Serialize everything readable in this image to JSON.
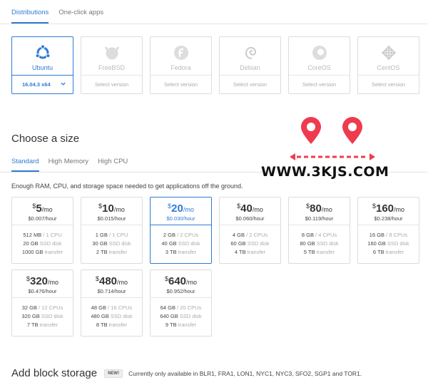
{
  "tabs": [
    "Distributions",
    "One-click apps"
  ],
  "distros": [
    {
      "name": "Ubuntu",
      "version": "16.04.3 x64",
      "icon": "ubuntu-icon",
      "selected": true
    },
    {
      "name": "FreeBSD",
      "version": "Select version",
      "icon": "freebsd-icon"
    },
    {
      "name": "Fedora",
      "version": "Select version",
      "icon": "fedora-icon"
    },
    {
      "name": "Debian",
      "version": "Select version",
      "icon": "debian-icon"
    },
    {
      "name": "CoreOS",
      "version": "Select version",
      "icon": "coreos-icon"
    },
    {
      "name": "CentOS",
      "version": "Select version",
      "icon": "centos-icon"
    }
  ],
  "size": {
    "heading": "Choose a size",
    "tabs": [
      "Standard",
      "High Memory",
      "High CPU"
    ],
    "description": "Enough RAM, CPU, and storage space needed to get applications off the ground."
  },
  "plans": [
    {
      "cur": "$",
      "amount": "5",
      "per": "/mo",
      "hourly": "$0.007/hour",
      "ram": "512 MB",
      "cpu": "1 CPU",
      "disk": "20 GB",
      "disk_label": "SSD disk",
      "transfer": "1000 GB",
      "transfer_label": "transfer"
    },
    {
      "cur": "$",
      "amount": "10",
      "per": "/mo",
      "hourly": "$0.015/hour",
      "ram": "1 GB",
      "cpu": "1 CPU",
      "disk": "30 GB",
      "disk_label": "SSD disk",
      "transfer": "2 TB",
      "transfer_label": "transfer"
    },
    {
      "cur": "$",
      "amount": "20",
      "per": "/mo",
      "hourly": "$0.030/hour",
      "ram": "2 GB",
      "cpu": "2 CPUs",
      "disk": "40 GB",
      "disk_label": "SSD disk",
      "transfer": "3 TB",
      "transfer_label": "transfer",
      "selected": true
    },
    {
      "cur": "$",
      "amount": "40",
      "per": "/mo",
      "hourly": "$0.060/hour",
      "ram": "4 GB",
      "cpu": "2 CPUs",
      "disk": "60 GB",
      "disk_label": "SSD disk",
      "transfer": "4 TB",
      "transfer_label": "transfer"
    },
    {
      "cur": "$",
      "amount": "80",
      "per": "/mo",
      "hourly": "$0.119/hour",
      "ram": "8 GB",
      "cpu": "4 CPUs",
      "disk": "80 GB",
      "disk_label": "SSD disk",
      "transfer": "5 TB",
      "transfer_label": "transfer"
    },
    {
      "cur": "$",
      "amount": "160",
      "per": "/mo",
      "hourly": "$0.238/hour",
      "ram": "16 GB",
      "cpu": "8 CPUs",
      "disk": "160 GB",
      "disk_label": "SSD disk",
      "transfer": "6 TB",
      "transfer_label": "transfer"
    },
    {
      "cur": "$",
      "amount": "320",
      "per": "/mo",
      "hourly": "$0.476/hour",
      "ram": "32 GB",
      "cpu": "12 CPUs",
      "disk": "320 GB",
      "disk_label": "SSD disk",
      "transfer": "7 TB",
      "transfer_label": "transfer"
    },
    {
      "cur": "$",
      "amount": "480",
      "per": "/mo",
      "hourly": "$0.714/hour",
      "ram": "48 GB",
      "cpu": "16 CPUs",
      "disk": "480 GB",
      "disk_label": "SSD disk",
      "transfer": "8 TB",
      "transfer_label": "transfer"
    },
    {
      "cur": "$",
      "amount": "640",
      "per": "/mo",
      "hourly": "$0.952/hour",
      "ram": "64 GB",
      "cpu": "20 CPUs",
      "disk": "640 GB",
      "disk_label": "SSD disk",
      "transfer": "9 TB",
      "transfer_label": "transfer"
    }
  ],
  "block_storage": {
    "heading": "Add block storage",
    "badge": "NEW!",
    "note": "Currently only available in BLR1, FRA1, LON1, NYC1, NYC3, SFO2, SGP1 and TOR1."
  },
  "watermark": {
    "text": "WWW.3KJS.COM"
  },
  "colors": {
    "accent": "#2f7ad6",
    "watermark_pin": "#ef3b4f"
  }
}
